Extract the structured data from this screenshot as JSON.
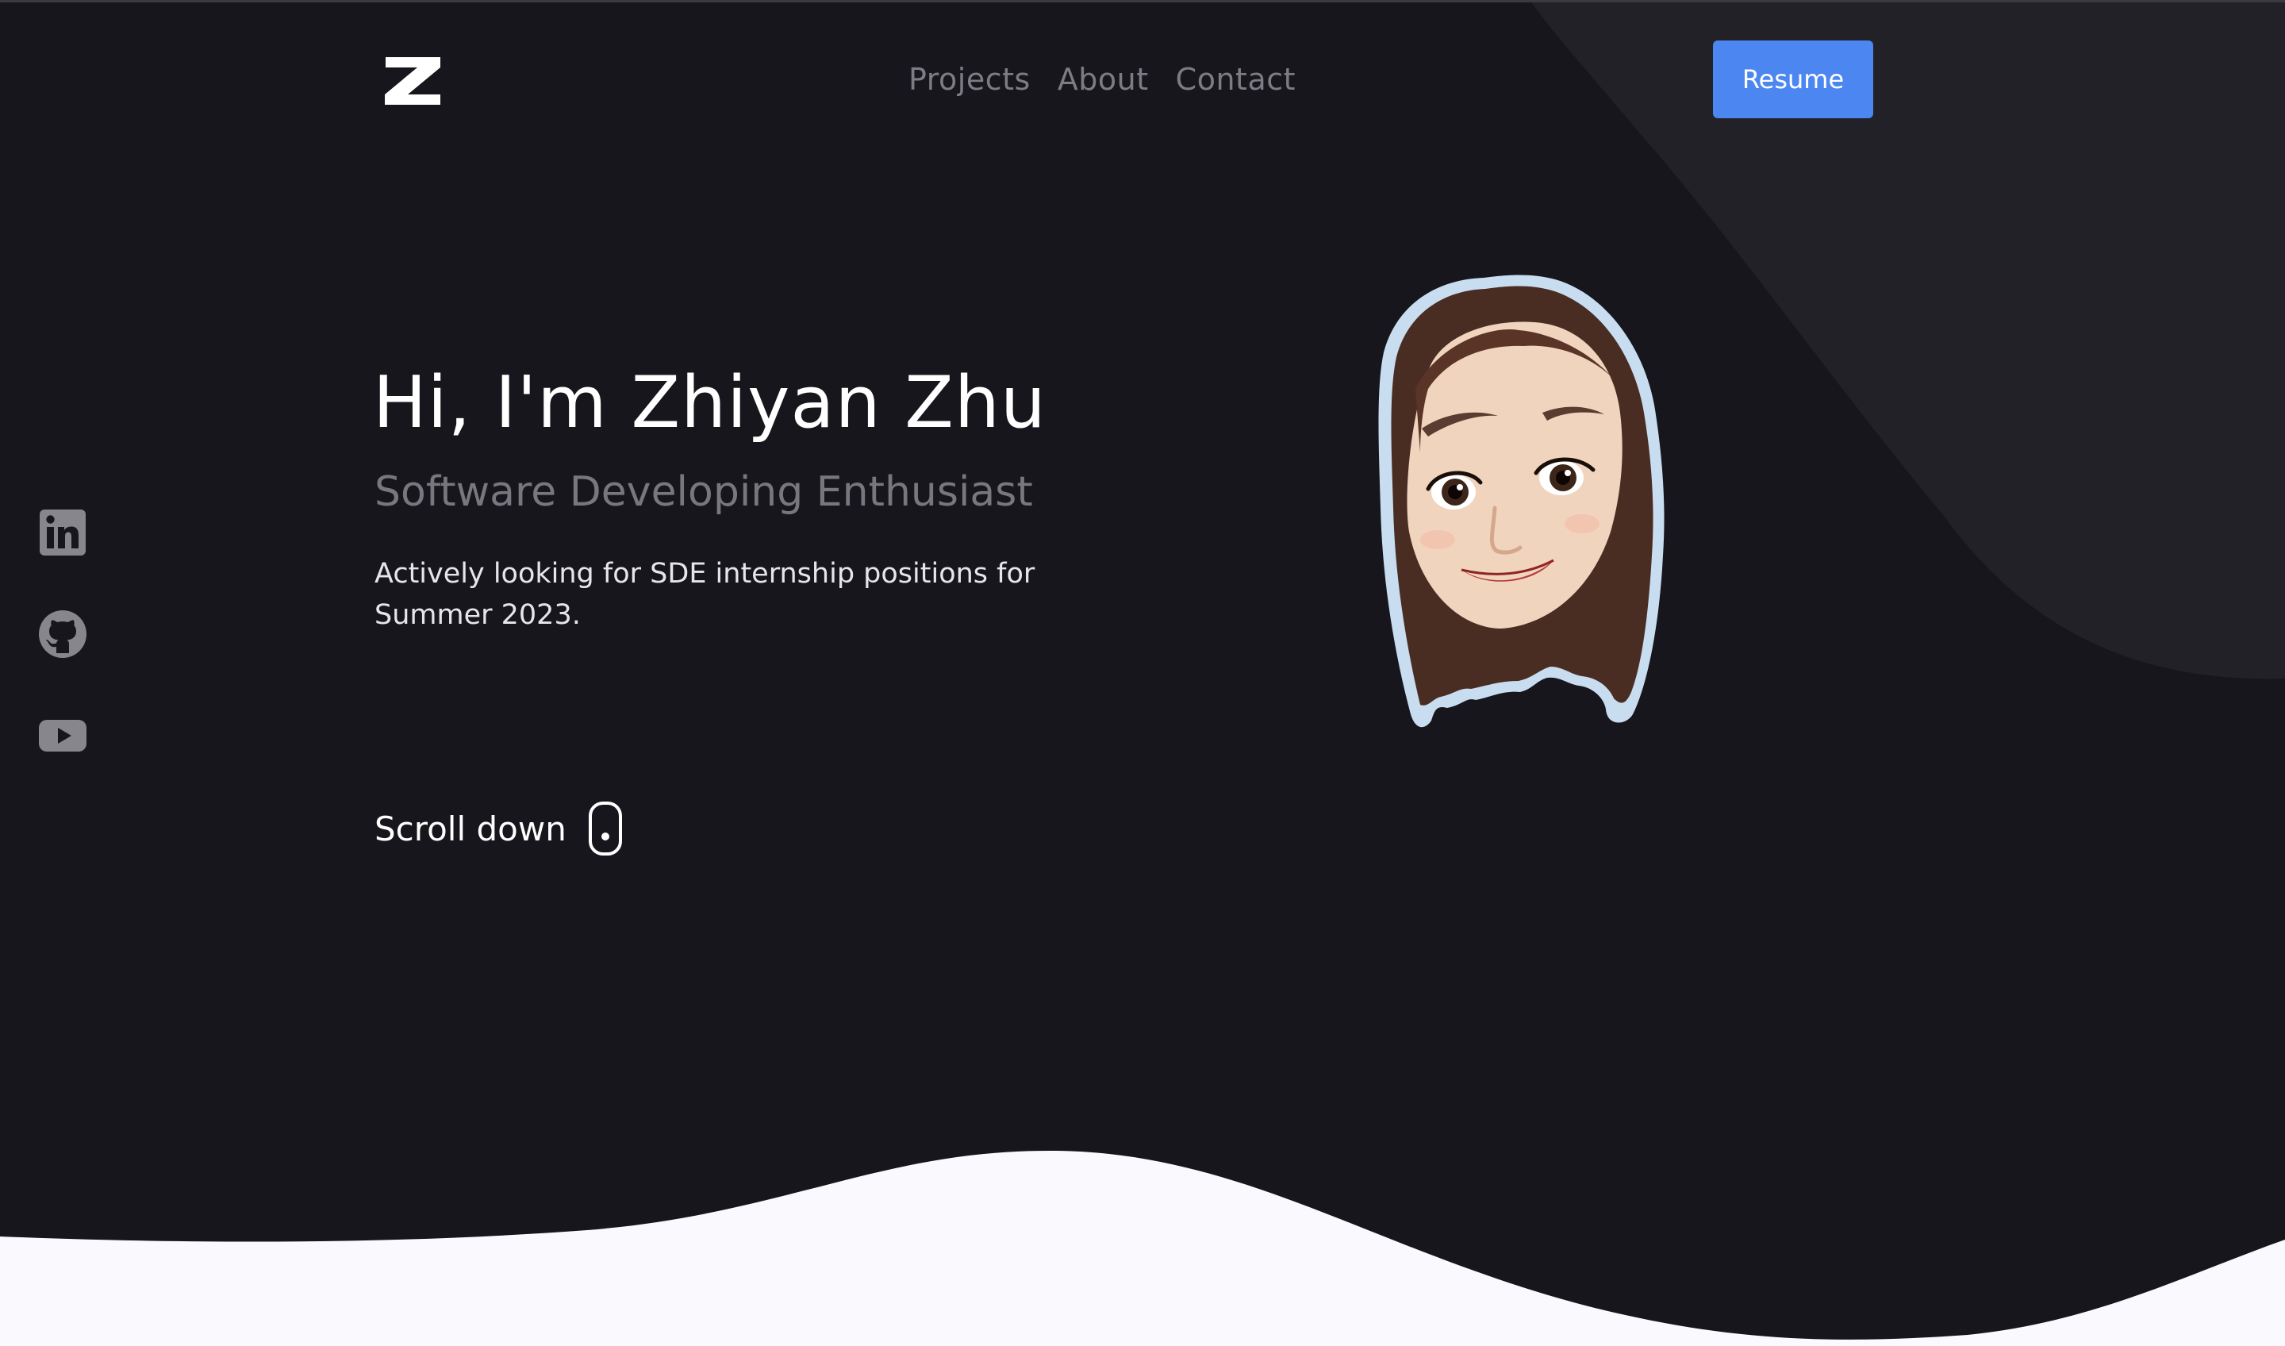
{
  "header": {
    "logo_icon": "z-logo-icon",
    "nav": [
      {
        "label": "Projects"
      },
      {
        "label": "About"
      },
      {
        "label": "Contact"
      }
    ],
    "resume_label": "Resume"
  },
  "socials": [
    {
      "icon": "linkedin-icon"
    },
    {
      "icon": "github-icon"
    },
    {
      "icon": "youtube-icon"
    }
  ],
  "hero": {
    "title": "Hi, I'm Zhiyan Zhu",
    "subtitle": "Software Developing Enthusiast",
    "description": "Actively looking for SDE internship positions for Summer 2023.",
    "scroll_label": "Scroll down",
    "avatar_icon": "memoji-avatar"
  },
  "colors": {
    "background": "#17161d",
    "accent_shape": "#222128",
    "button": "#4c86f0",
    "wave": "#faf9fe",
    "nav_text": "#7c7c83",
    "subtitle_text": "#77777d"
  }
}
